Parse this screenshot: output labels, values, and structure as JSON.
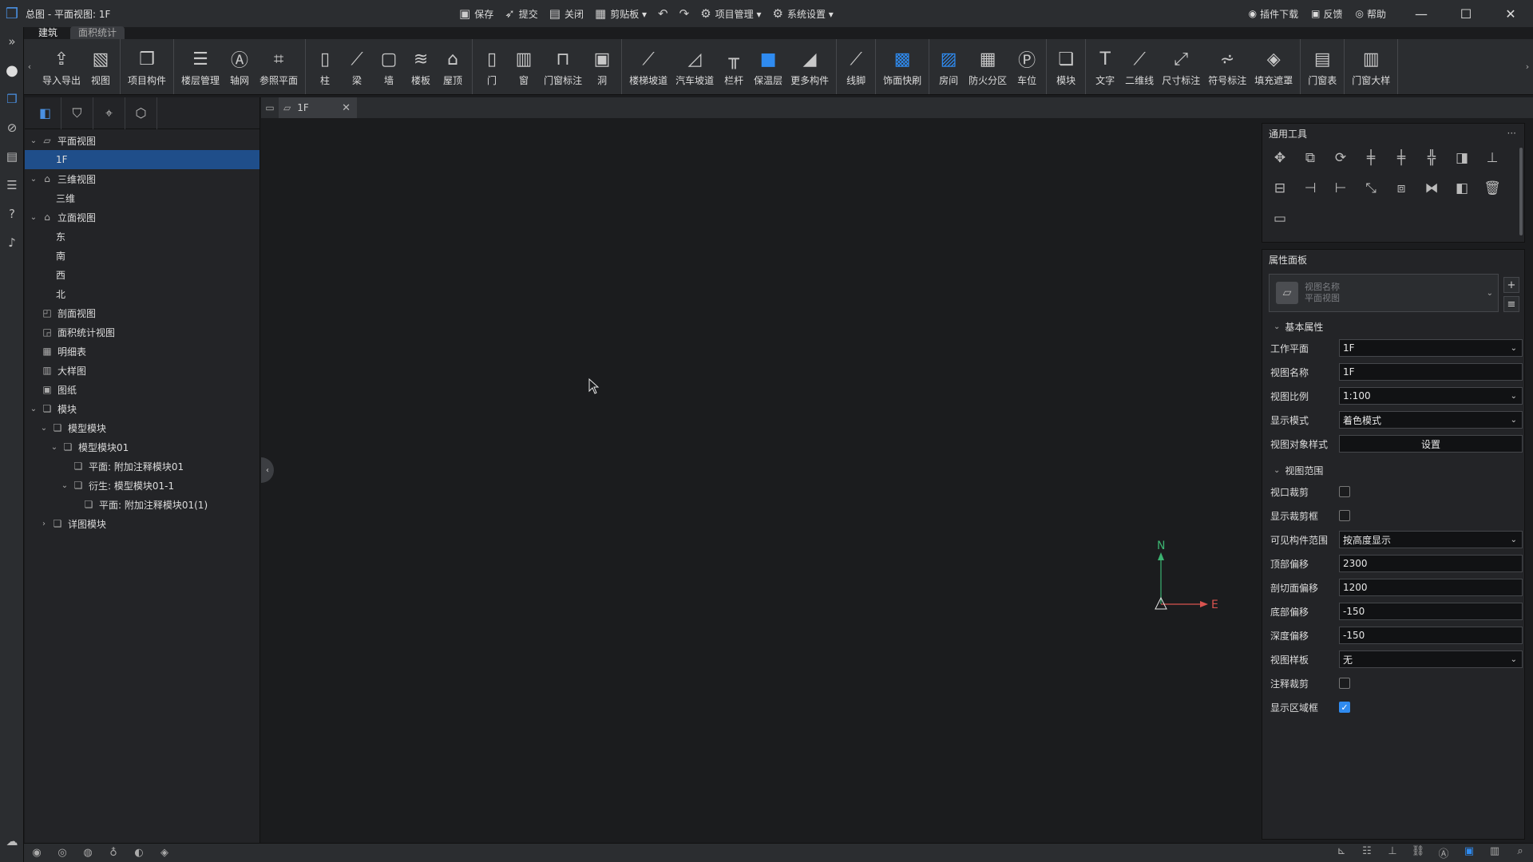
{
  "titlebar": {
    "title": "总图 - 平面视图: 1F",
    "quick": [
      {
        "icon": "save-icon",
        "glyph": "▣",
        "label": "保存"
      },
      {
        "icon": "submit-icon",
        "glyph": "➶",
        "label": "提交"
      },
      {
        "icon": "close-doc-icon",
        "glyph": "▤",
        "label": "关闭"
      },
      {
        "icon": "clipboard-icon",
        "glyph": "▦",
        "label": "剪贴板 ▾"
      },
      {
        "icon": "undo-icon",
        "glyph": "↶",
        "label": ""
      },
      {
        "icon": "redo-icon",
        "glyph": "↷",
        "label": ""
      },
      {
        "icon": "project-manage-icon",
        "glyph": "⚙",
        "label": "项目管理 ▾"
      },
      {
        "icon": "system-settings-icon",
        "glyph": "⚙",
        "label": "系统设置 ▾"
      }
    ],
    "right": [
      {
        "icon": "plugin-download-icon",
        "glyph": "◉",
        "label": "插件下载"
      },
      {
        "icon": "feedback-icon",
        "glyph": "▣",
        "label": "反馈"
      },
      {
        "icon": "help-icon",
        "glyph": "◎",
        "label": "帮助"
      }
    ]
  },
  "ribbon_tabs": [
    "建筑",
    "面积统计"
  ],
  "ribbon": {
    "groups": [
      [
        {
          "icon": "import-export-icon",
          "glyph": "⇪",
          "label": "导入导出"
        },
        {
          "icon": "view-icon",
          "glyph": "▧",
          "label": "视图"
        }
      ],
      [
        {
          "icon": "project-component-icon",
          "glyph": "❒",
          "label": "项目构件"
        }
      ],
      [
        {
          "icon": "floor-manage-icon",
          "glyph": "☰",
          "label": "楼层管理"
        },
        {
          "icon": "axis-grid-icon",
          "glyph": "Ⓐ",
          "label": "轴网"
        },
        {
          "icon": "ref-plane-icon",
          "glyph": "⌗",
          "label": "参照平面"
        }
      ],
      [
        {
          "icon": "column-icon",
          "glyph": "▯",
          "label": "柱"
        },
        {
          "icon": "beam-icon",
          "glyph": "⟋",
          "label": "梁"
        },
        {
          "icon": "wall-icon",
          "glyph": "▢",
          "label": "墙"
        },
        {
          "icon": "slab-icon",
          "glyph": "≋",
          "label": "楼板"
        },
        {
          "icon": "roof-icon",
          "glyph": "⌂",
          "label": "屋顶"
        }
      ],
      [
        {
          "icon": "door-icon",
          "glyph": "▯",
          "label": "门"
        },
        {
          "icon": "window-icon",
          "glyph": "▥",
          "label": "窗"
        },
        {
          "icon": "door-window-tag-icon",
          "glyph": "⊓",
          "label": "门窗标注"
        },
        {
          "icon": "opening-icon",
          "glyph": "▣",
          "label": "洞"
        }
      ],
      [
        {
          "icon": "stair-ramp-icon",
          "glyph": "⟋",
          "label": "楼梯坡道"
        },
        {
          "icon": "car-ramp-icon",
          "glyph": "◿",
          "label": "汽车坡道"
        },
        {
          "icon": "railing-icon",
          "glyph": "╥",
          "label": "栏杆"
        },
        {
          "icon": "insulation-icon",
          "glyph": "■",
          "label": "保温层"
        },
        {
          "icon": "more-components-icon",
          "glyph": "◢",
          "label": "更多构件"
        }
      ],
      [
        {
          "icon": "baseboard-icon",
          "glyph": "⟋",
          "label": "线脚"
        }
      ],
      [
        {
          "icon": "finish-block-icon",
          "glyph": "▩",
          "label": "饰面快刷"
        }
      ],
      [
        {
          "icon": "room-icon",
          "glyph": "▨",
          "label": "房间"
        },
        {
          "icon": "fire-zone-icon",
          "glyph": "▦",
          "label": "防火分区"
        },
        {
          "icon": "parking-icon",
          "glyph": "Ⓟ",
          "label": "车位"
        }
      ],
      [
        {
          "icon": "module-icon",
          "glyph": "❏",
          "label": "模块"
        }
      ],
      [
        {
          "icon": "text-icon",
          "glyph": "T",
          "label": "文字"
        },
        {
          "icon": "line-2d-icon",
          "glyph": "⟋",
          "label": "二维线"
        },
        {
          "icon": "dimension-icon",
          "glyph": "⤢",
          "label": "尺寸标注"
        },
        {
          "icon": "symbol-tag-icon",
          "glyph": "⩫",
          "label": "符号标注"
        },
        {
          "icon": "fill-mask-icon",
          "glyph": "◈",
          "label": "填充遮罩"
        }
      ],
      [
        {
          "icon": "door-window-table-icon",
          "glyph": "▤",
          "label": "门窗表"
        }
      ],
      [
        {
          "icon": "door-window-detail-icon",
          "glyph": "▥",
          "label": "门窗大样"
        }
      ]
    ]
  },
  "tree": [
    {
      "level": 0,
      "exp": "v",
      "icon": "plan-view-icon",
      "glyph": "▱",
      "label": "平面视图",
      "selected": false
    },
    {
      "level": 1,
      "exp": "",
      "icon": "",
      "glyph": "",
      "label": "1F",
      "selected": true
    },
    {
      "level": 0,
      "exp": "v",
      "icon": "3d-view-icon",
      "glyph": "⌂",
      "label": "三维视图",
      "selected": false
    },
    {
      "level": 1,
      "exp": "",
      "icon": "",
      "glyph": "",
      "label": "三维",
      "selected": false
    },
    {
      "level": 0,
      "exp": "v",
      "icon": "elevation-view-icon",
      "glyph": "⌂",
      "label": "立面视图",
      "selected": false
    },
    {
      "level": 1,
      "exp": "",
      "icon": "",
      "glyph": "",
      "label": "东",
      "selected": false
    },
    {
      "level": 1,
      "exp": "",
      "icon": "",
      "glyph": "",
      "label": "南",
      "selected": false
    },
    {
      "level": 1,
      "exp": "",
      "icon": "",
      "glyph": "",
      "label": "西",
      "selected": false
    },
    {
      "level": 1,
      "exp": "",
      "icon": "",
      "glyph": "",
      "label": "北",
      "selected": false
    },
    {
      "level": 0,
      "exp": "",
      "icon": "section-view-icon",
      "glyph": "◰",
      "label": "剖面视图",
      "selected": false
    },
    {
      "level": 0,
      "exp": "",
      "icon": "area-stat-view-icon",
      "glyph": "◲",
      "label": "面积统计视图",
      "selected": false
    },
    {
      "level": 0,
      "exp": "",
      "icon": "schedule-icon",
      "glyph": "▦",
      "label": "明细表",
      "selected": false
    },
    {
      "level": 0,
      "exp": "",
      "icon": "detail-drawing-icon",
      "glyph": "▥",
      "label": "大样图",
      "selected": false
    },
    {
      "level": 0,
      "exp": "",
      "icon": "sheet-icon",
      "glyph": "▣",
      "label": "图纸",
      "selected": false
    },
    {
      "level": 0,
      "exp": "v",
      "icon": "module-tree-icon",
      "glyph": "❏",
      "label": "模块",
      "selected": false
    },
    {
      "level": 1,
      "exp": "v",
      "icon": "model-module-icon",
      "glyph": "❏",
      "label": "模型模块",
      "selected": false
    },
    {
      "level": 2,
      "exp": "v",
      "icon": "model-module-icon",
      "glyph": "❏",
      "label": "模型模块01",
      "selected": false
    },
    {
      "level": 3,
      "exp": "",
      "icon": "plan-module-icon",
      "glyph": "❏",
      "label": "平面: 附加注释模块01",
      "selected": false
    },
    {
      "level": 3,
      "exp": "v",
      "icon": "derived-module-icon",
      "glyph": "❏",
      "label": "衍生: 模型模块01-1",
      "selected": false
    },
    {
      "level": 4,
      "exp": "",
      "icon": "plan-module-icon",
      "glyph": "❏",
      "label": "平面: 附加注释模块01(1)",
      "selected": false
    },
    {
      "level": 1,
      "exp": ">",
      "icon": "detail-module-icon",
      "glyph": "❏",
      "label": "详图模块",
      "selected": false
    }
  ],
  "doc_tab": {
    "label": "1F"
  },
  "compass": {
    "north": "N",
    "east": "E"
  },
  "tools_panel": {
    "title": "通用工具"
  },
  "tools": [
    {
      "icon": "move-icon",
      "glyph": "✥"
    },
    {
      "icon": "copy-icon",
      "glyph": "⧉"
    },
    {
      "icon": "rotate-icon",
      "glyph": "⟳"
    },
    {
      "icon": "align-icon",
      "glyph": "╪"
    },
    {
      "icon": "split-icon",
      "glyph": "╪"
    },
    {
      "icon": "trim-icon",
      "glyph": "╬"
    },
    {
      "icon": "offset-icon",
      "glyph": "◨"
    },
    {
      "icon": "extend-icon",
      "glyph": "⊥"
    },
    {
      "icon": "align-bottom-icon",
      "glyph": "⊟"
    },
    {
      "icon": "break-icon",
      "glyph": "⊣"
    },
    {
      "icon": "break-point-icon",
      "glyph": "⊢"
    },
    {
      "icon": "scale-icon",
      "glyph": "⤡"
    },
    {
      "icon": "array-icon",
      "glyph": "⧈"
    },
    {
      "icon": "mirror-icon",
      "glyph": "⧓"
    },
    {
      "icon": "group-icon",
      "glyph": "◧"
    },
    {
      "icon": "delete-icon",
      "glyph": "🗑"
    },
    {
      "icon": "measure-icon",
      "glyph": "▭"
    }
  ],
  "props_panel": {
    "title": "属性面板",
    "view_name_label": "视图名称",
    "view_type": "平面视图",
    "sections": [
      {
        "title": "基本属性",
        "rows": [
          {
            "label": "工作平面",
            "type": "select",
            "value": "1F"
          },
          {
            "label": "视图名称",
            "type": "text",
            "value": "1F"
          },
          {
            "label": "视图比例",
            "type": "select",
            "value": "1:100"
          },
          {
            "label": "显示模式",
            "type": "select",
            "value": "着色模式"
          },
          {
            "label": "视图对象样式",
            "type": "button",
            "value": "设置"
          }
        ]
      },
      {
        "title": "视图范围",
        "rows": [
          {
            "label": "视口裁剪",
            "type": "check",
            "value": false
          },
          {
            "label": "显示裁剪框",
            "type": "check",
            "value": false
          },
          {
            "label": "可见构件范围",
            "type": "select",
            "value": "按高度显示"
          },
          {
            "label": "顶部偏移",
            "type": "text",
            "value": "2300"
          },
          {
            "label": "剖切面偏移",
            "type": "text",
            "value": "1200"
          },
          {
            "label": "底部偏移",
            "type": "text",
            "value": "-150"
          },
          {
            "label": "深度偏移",
            "type": "text",
            "value": "-150"
          },
          {
            "label": "视图样板",
            "type": "select",
            "value": "无"
          },
          {
            "label": "注释裁剪",
            "type": "check",
            "value": false
          },
          {
            "label": "显示区域框",
            "type": "check",
            "value": true
          }
        ]
      }
    ]
  },
  "colors": {
    "accent": "#2f8bf0",
    "selected": "#1f4e8a",
    "north": "#3cb371",
    "east": "#d9534f"
  }
}
